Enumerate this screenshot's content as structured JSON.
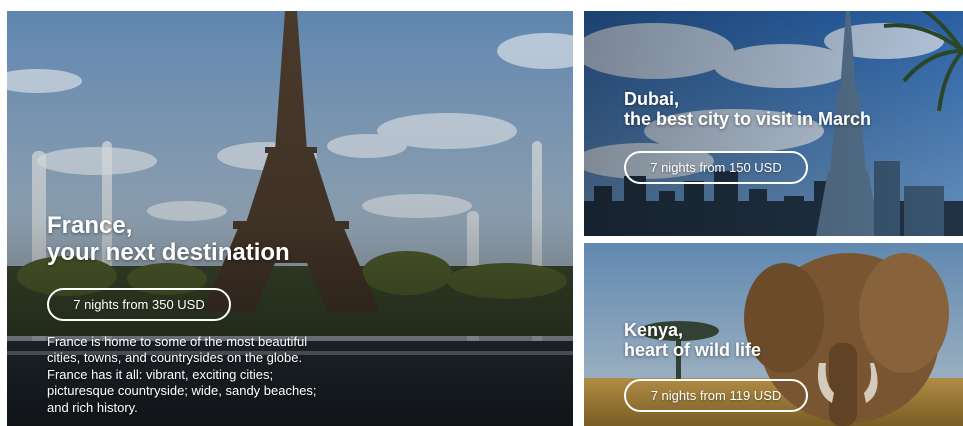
{
  "cards": {
    "france": {
      "title_line1": "France,",
      "title_line2": "your next destination",
      "price": "7 nights from 350 USD",
      "description": "France is home to some of the most beautiful cities, towns, and countrysides on the globe. France has it all: vibrant, exciting cities; picturesque countryside; wide, sandy beaches; and rich history.",
      "image": "eiffel-tower-photo"
    },
    "dubai": {
      "title_line1": "Dubai,",
      "title_line2": "the best city to visit in March",
      "price": "7 nights from 150 USD",
      "image": "burj-khalifa-photo"
    },
    "kenya": {
      "title_line1": "Kenya,",
      "title_line2": "heart of wild life",
      "price": "7 nights from 119 USD",
      "image": "elephant-savanna-photo"
    }
  },
  "colors": {
    "text": "#ffffff",
    "button_border": "#ffffff",
    "france_sky": "#6d8fb3",
    "dubai_sky": "#2f6fb4",
    "kenya_sky": "#7ea8cf",
    "savanna": "#c9a04e"
  }
}
